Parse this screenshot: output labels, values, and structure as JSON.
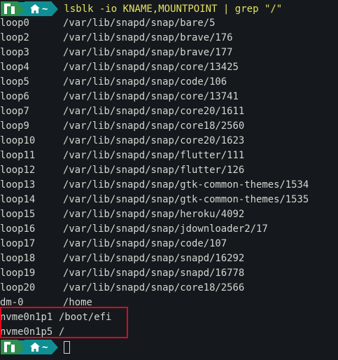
{
  "prompt_top": {
    "distro_icon": "manjaro-logo-icon",
    "home_icon": "home-icon",
    "path": "~",
    "command": "lsblk -io KNAME,MOUNTPOINT | grep \"/\""
  },
  "output": [
    {
      "kname": "loop0",
      "mount": "/var/lib/snapd/snap/bare/5"
    },
    {
      "kname": "loop2",
      "mount": "/var/lib/snapd/snap/brave/176"
    },
    {
      "kname": "loop3",
      "mount": "/var/lib/snapd/snap/brave/177"
    },
    {
      "kname": "loop4",
      "mount": "/var/lib/snapd/snap/core/13425"
    },
    {
      "kname": "loop5",
      "mount": "/var/lib/snapd/snap/code/106"
    },
    {
      "kname": "loop6",
      "mount": "/var/lib/snapd/snap/core/13741"
    },
    {
      "kname": "loop7",
      "mount": "/var/lib/snapd/snap/core20/1611"
    },
    {
      "kname": "loop9",
      "mount": "/var/lib/snapd/snap/core18/2560"
    },
    {
      "kname": "loop10",
      "mount": "/var/lib/snapd/snap/core20/1623"
    },
    {
      "kname": "loop11",
      "mount": "/var/lib/snapd/snap/flutter/111"
    },
    {
      "kname": "loop12",
      "mount": "/var/lib/snapd/snap/flutter/126"
    },
    {
      "kname": "loop13",
      "mount": "/var/lib/snapd/snap/gtk-common-themes/1534"
    },
    {
      "kname": "loop14",
      "mount": "/var/lib/snapd/snap/gtk-common-themes/1535"
    },
    {
      "kname": "loop15",
      "mount": "/var/lib/snapd/snap/heroku/4092"
    },
    {
      "kname": "loop16",
      "mount": "/var/lib/snapd/snap/jdownloader2/17"
    },
    {
      "kname": "loop17",
      "mount": "/var/lib/snapd/snap/code/107"
    },
    {
      "kname": "loop18",
      "mount": "/var/lib/snapd/snap/snapd/16292"
    },
    {
      "kname": "loop19",
      "mount": "/var/lib/snapd/snap/snapd/16778"
    },
    {
      "kname": "loop20",
      "mount": "/var/lib/snapd/snap/core18/2566"
    },
    {
      "kname": "dm-0",
      "mount": "/home"
    },
    {
      "kname": "nvme0n1p1",
      "mount": "/boot/efi"
    },
    {
      "kname": "nvme0n1p5",
      "mount": "/"
    }
  ],
  "prompt_bottom": {
    "distro_icon": "manjaro-logo-icon",
    "home_icon": "home-icon",
    "path": "~"
  },
  "colors": {
    "background": "#15191e",
    "text": "#d3d7cf",
    "command": "#e5e15f",
    "prompt_distro_segment": "#2f8f4e",
    "prompt_path_segment": "#0f8f93",
    "highlight_box": "#e3051b"
  }
}
